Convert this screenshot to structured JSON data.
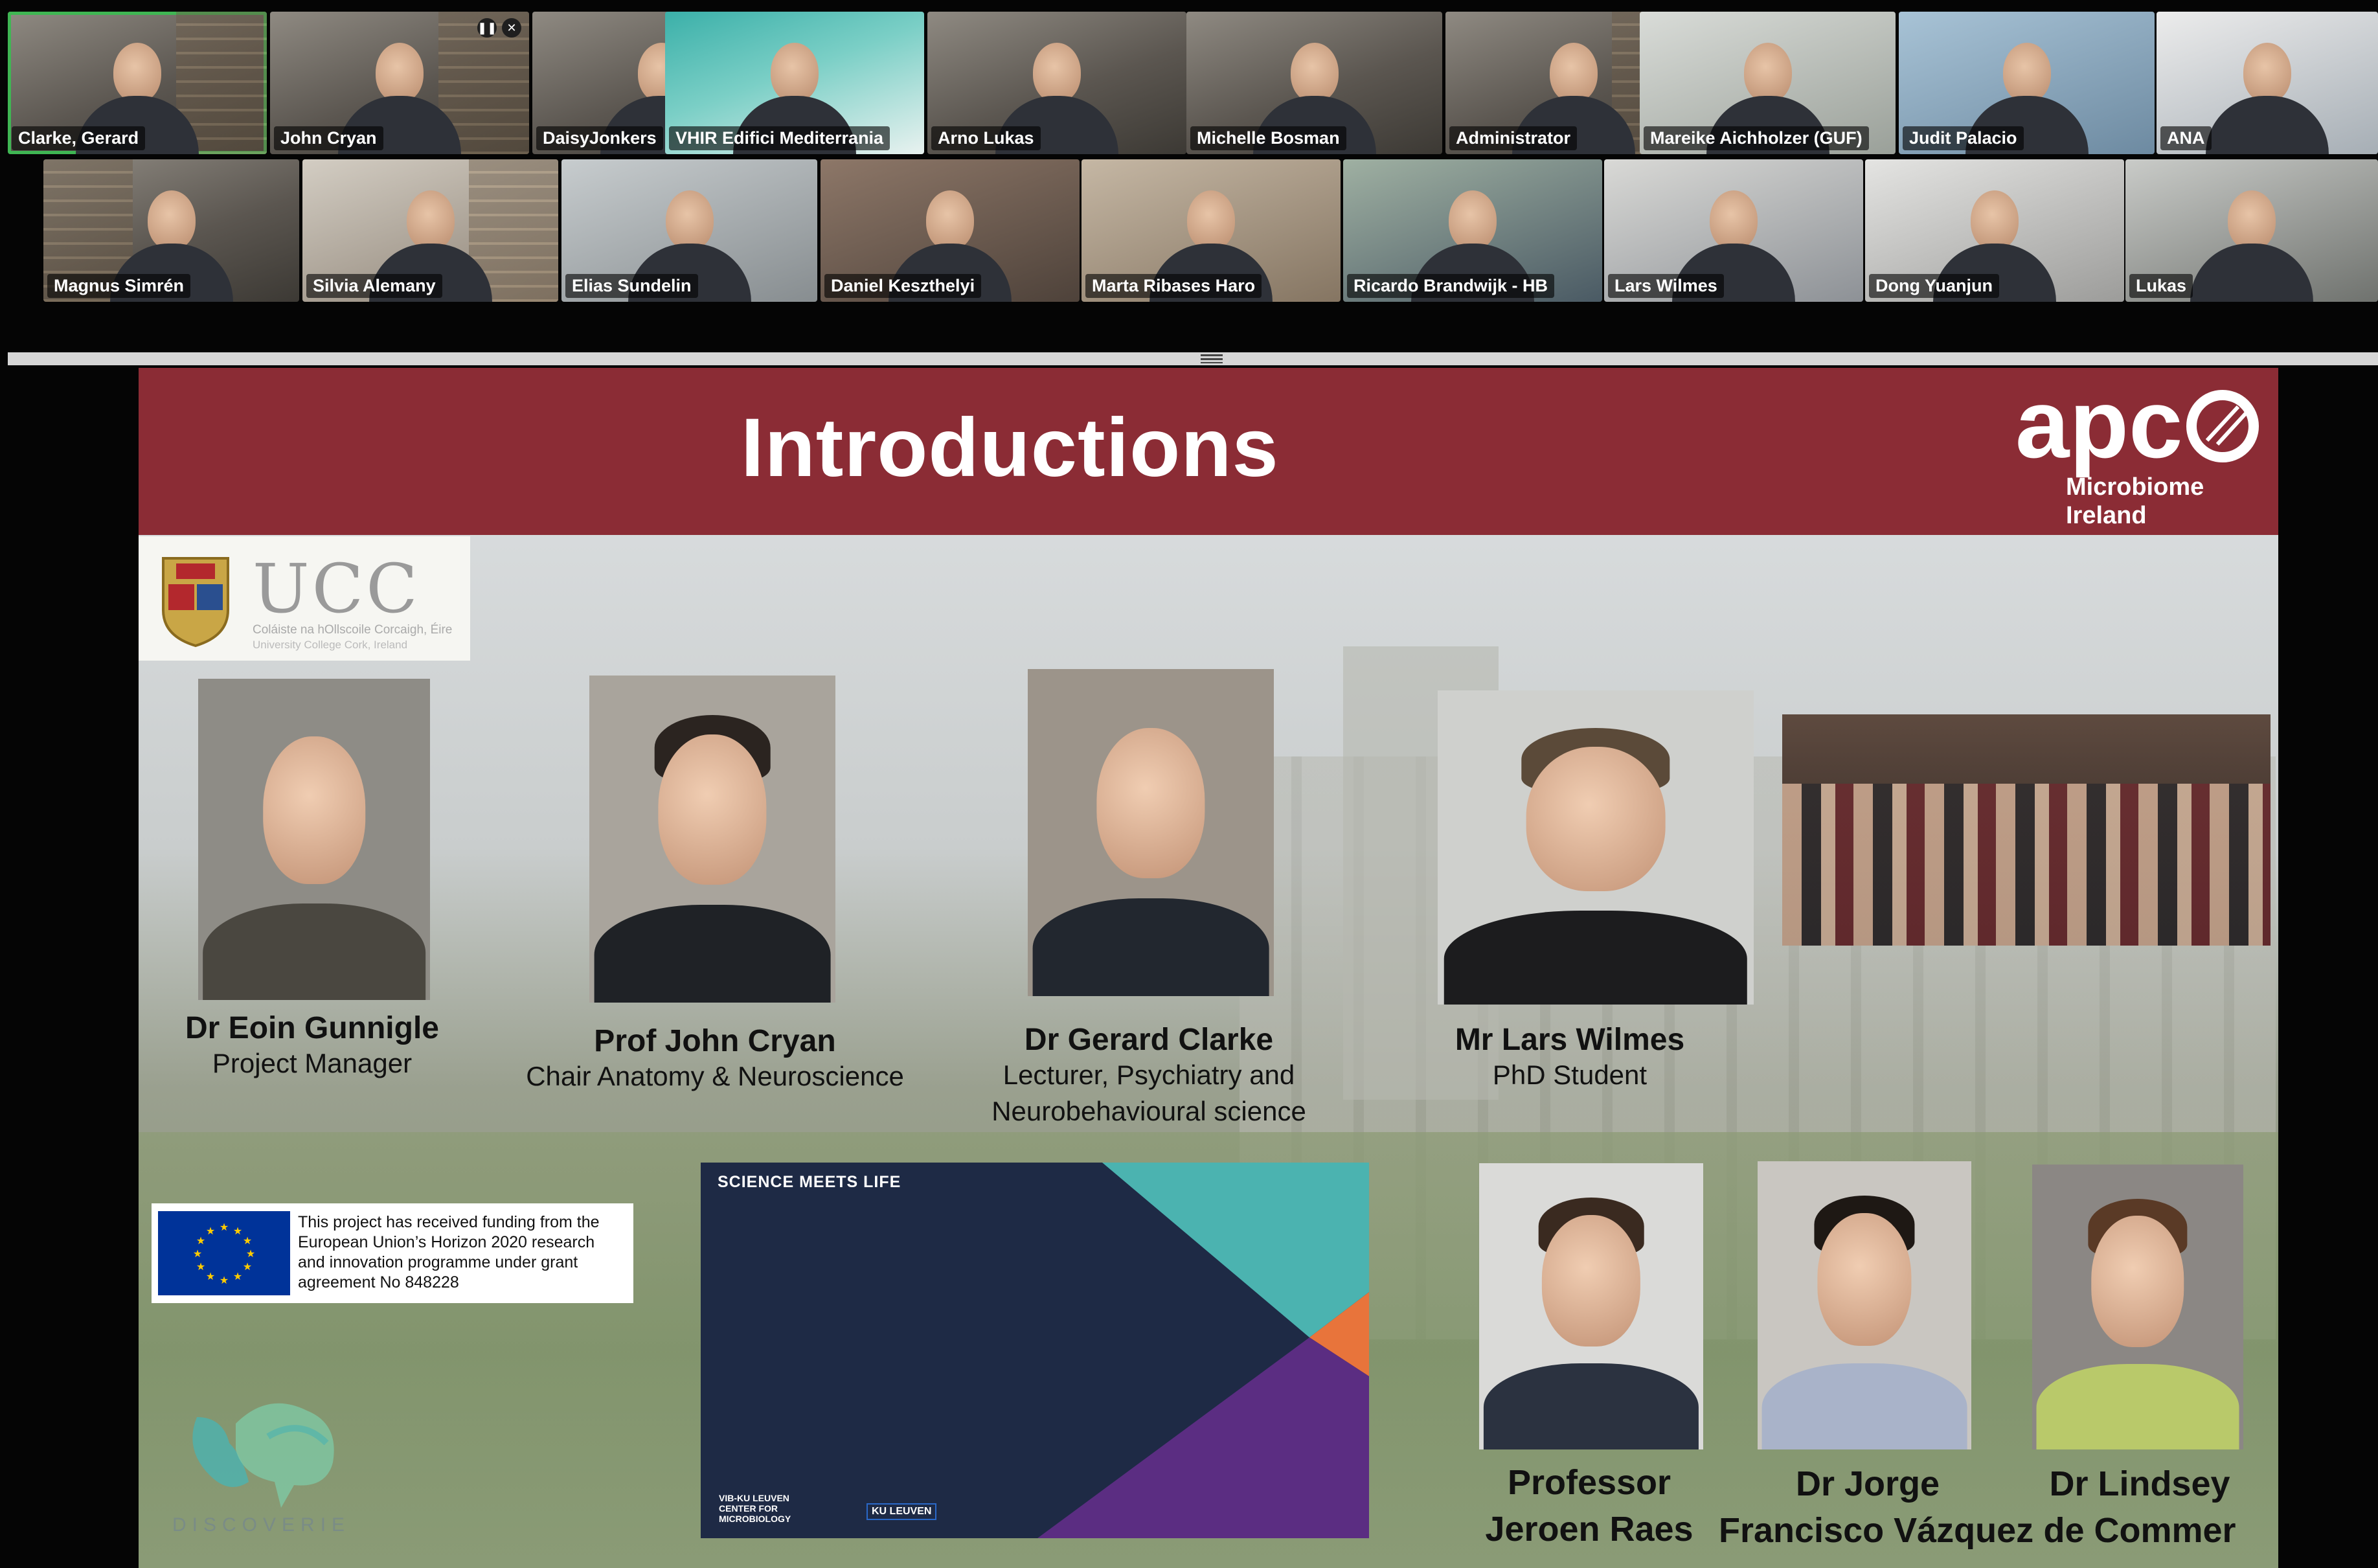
{
  "gallery": {
    "row1": [
      {
        "name": "Clarke, Gerard",
        "active": true
      },
      {
        "name": "John Cryan",
        "active": false
      },
      {
        "name": "DaisyJonkers",
        "active": false
      },
      {
        "name": "VHIR Edifici Mediterrania",
        "active": false
      },
      {
        "name": "Arno Lukas",
        "active": false
      },
      {
        "name": "Michelle Bosman",
        "active": false
      },
      {
        "name": "Administrator",
        "active": false
      },
      {
        "name": "Mareike Aichholzer (GUF)",
        "active": false
      },
      {
        "name": "Judit Palacio",
        "active": false
      },
      {
        "name": "ANA",
        "active": false
      }
    ],
    "row2": [
      {
        "name": "Magnus Simrén"
      },
      {
        "name": "Silvia Alemany"
      },
      {
        "name": "Elias Sundelin"
      },
      {
        "name": "Daniel Keszthelyi"
      },
      {
        "name": "Marta Ribases Haro"
      },
      {
        "name": "Ricardo Brandwijk - HB"
      },
      {
        "name": "Lars Wilmes"
      },
      {
        "name": "Dong Yuanjun"
      },
      {
        "name": "Lukas"
      }
    ],
    "tile_controls": {
      "pause": "❚❚",
      "close": "✕"
    }
  },
  "slide": {
    "title": "Introductions",
    "logo": {
      "mark": "apc",
      "line1": "Microbiome",
      "line2": "Ireland"
    },
    "ucc": {
      "word": "UCC",
      "sub1": "Coláiste na hOllscoile Corcaigh, Éire",
      "sub2": "University College Cork, Ireland"
    },
    "people_top": [
      {
        "name": "Dr Eoin Gunnigle",
        "role": "Project Manager"
      },
      {
        "name": "Prof John Cryan",
        "role": "Chair Anatomy & Neuroscience"
      },
      {
        "name": "Dr Gerard Clarke",
        "role": "Lecturer, Psychiatry and",
        "role2": "Neurobehavioural science"
      },
      {
        "name": "Mr Lars Wilmes",
        "role": "PhD Student"
      }
    ],
    "people_bottom": [
      {
        "name": "Professor",
        "name2": "Jeroen Raes"
      },
      {
        "name": "Dr Jorge",
        "name2": "Francisco Vázquez"
      },
      {
        "name": "Dr Lindsey",
        "name2": "de Commer"
      }
    ],
    "eu_funding": [
      "This project has received funding from the",
      "European Union’s Horizon 2020 research",
      "and innovation programme under grant",
      "agreement No 848228"
    ],
    "video": {
      "label": "SCIENCE MEETS LIFE",
      "foot1": "VIB-KU LEUVEN",
      "foot2": "CENTER FOR",
      "foot3": "MICROBIOLOGY",
      "kul": "KU LEUVEN"
    },
    "discoverie": "DISCOVERIE"
  },
  "colors": {
    "header": "#8b2c35",
    "active_speaker": "#3fb653",
    "video_bg": "#1e2a45",
    "teal": "#4bb3b0",
    "orange": "#e8743b",
    "purple": "#5b2d82"
  }
}
